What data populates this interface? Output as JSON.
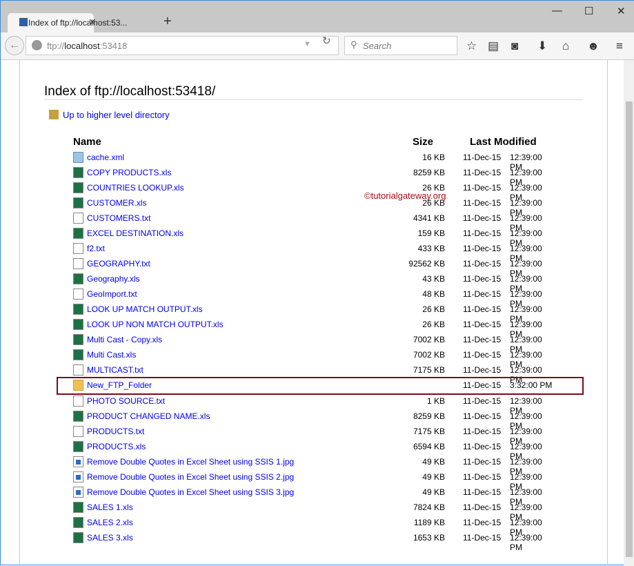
{
  "browser": {
    "tab_title": "Index of ftp://localhost:53...",
    "url_prefix": "ftp://",
    "url_host": "localhost",
    ":": "",
    "url_port": ":53418",
    "search_placeholder": "Search"
  },
  "page": {
    "title": "Index of ftp://localhost:53418/",
    "up_link": "Up to higher level directory",
    "headers": {
      "name": "Name",
      "size": "Size",
      "modified": "Last Modified"
    },
    "watermark": "©tutorialgateway.org"
  },
  "files": [
    {
      "name": "cache.xml",
      "type": "xml",
      "size": "16 KB",
      "date": "11-Dec-15",
      "time": "12:39:00 PM"
    },
    {
      "name": "COPY PRODUCTS.xls",
      "type": "xls",
      "size": "8259 KB",
      "date": "11-Dec-15",
      "time": "12:39:00 PM"
    },
    {
      "name": "COUNTRIES LOOKUP.xls",
      "type": "xls",
      "size": "26 KB",
      "date": "11-Dec-15",
      "time": "12:39:00 PM"
    },
    {
      "name": "CUSTOMER.xls",
      "type": "xls",
      "size": "26 KB",
      "date": "11-Dec-15",
      "time": "12:39:00 PM"
    },
    {
      "name": "CUSTOMERS.txt",
      "type": "txt",
      "size": "4341 KB",
      "date": "11-Dec-15",
      "time": "12:39:00 PM"
    },
    {
      "name": "EXCEL DESTINATION.xls",
      "type": "xls",
      "size": "159 KB",
      "date": "11-Dec-15",
      "time": "12:39:00 PM"
    },
    {
      "name": "f2.txt",
      "type": "txt",
      "size": "433 KB",
      "date": "11-Dec-15",
      "time": "12:39:00 PM"
    },
    {
      "name": "GEOGRAPHY.txt",
      "type": "txt",
      "size": "92562 KB",
      "date": "11-Dec-15",
      "time": "12:39:00 PM"
    },
    {
      "name": "Geography.xls",
      "type": "xls",
      "size": "43 KB",
      "date": "11-Dec-15",
      "time": "12:39:00 PM"
    },
    {
      "name": "GeoImport.txt",
      "type": "txt",
      "size": "48 KB",
      "date": "11-Dec-15",
      "time": "12:39:00 PM"
    },
    {
      "name": "LOOK UP MATCH OUTPUT.xls",
      "type": "xls",
      "size": "26 KB",
      "date": "11-Dec-15",
      "time": "12:39:00 PM"
    },
    {
      "name": "LOOK UP NON MATCH OUTPUT.xls",
      "type": "xls",
      "size": "26 KB",
      "date": "11-Dec-15",
      "time": "12:39:00 PM"
    },
    {
      "name": "Multi Cast - Copy.xls",
      "type": "xls",
      "size": "7002 KB",
      "date": "11-Dec-15",
      "time": "12:39:00 PM"
    },
    {
      "name": "Multi Cast.xls",
      "type": "xls",
      "size": "7002 KB",
      "date": "11-Dec-15",
      "time": "12:39:00 PM"
    },
    {
      "name": "MULTICAST.txt",
      "type": "txt",
      "size": "7175 KB",
      "date": "11-Dec-15",
      "time": "12:39:00 PM"
    },
    {
      "name": "New_FTP_Folder",
      "type": "folder",
      "size": "",
      "date": "11-Dec-15",
      "time": "3:32:00 PM"
    },
    {
      "name": "PHOTO SOURCE.txt",
      "type": "txt",
      "size": "1 KB",
      "date": "11-Dec-15",
      "time": "12:39:00 PM"
    },
    {
      "name": "PRODUCT CHANGED NAME.xls",
      "type": "xls",
      "size": "8259 KB",
      "date": "11-Dec-15",
      "time": "12:39:00 PM"
    },
    {
      "name": "PRODUCTS.txt",
      "type": "txt",
      "size": "7175 KB",
      "date": "11-Dec-15",
      "time": "12:39:00 PM"
    },
    {
      "name": "PRODUCTS.xls",
      "type": "xls",
      "size": "6594 KB",
      "date": "11-Dec-15",
      "time": "12:39:00 PM"
    },
    {
      "name": "Remove Double Quotes in Excel Sheet using SSIS 1.jpg",
      "type": "jpg",
      "size": "49 KB",
      "date": "11-Dec-15",
      "time": "12:39:00 PM"
    },
    {
      "name": "Remove Double Quotes in Excel Sheet using SSIS 2.jpg",
      "type": "jpg",
      "size": "49 KB",
      "date": "11-Dec-15",
      "time": "12:39:00 PM"
    },
    {
      "name": "Remove Double Quotes in Excel Sheet using SSIS 3.jpg",
      "type": "jpg",
      "size": "49 KB",
      "date": "11-Dec-15",
      "time": "12:39:00 PM"
    },
    {
      "name": "SALES 1.xls",
      "type": "xls",
      "size": "7824 KB",
      "date": "11-Dec-15",
      "time": "12:39:00 PM"
    },
    {
      "name": "SALES 2.xls",
      "type": "xls",
      "size": "1189 KB",
      "date": "11-Dec-15",
      "time": "12:39:00 PM"
    },
    {
      "name": "SALES 3.xls",
      "type": "xls",
      "size": "1653 KB",
      "date": "11-Dec-15",
      "time": "12:39:00 PM"
    }
  ]
}
